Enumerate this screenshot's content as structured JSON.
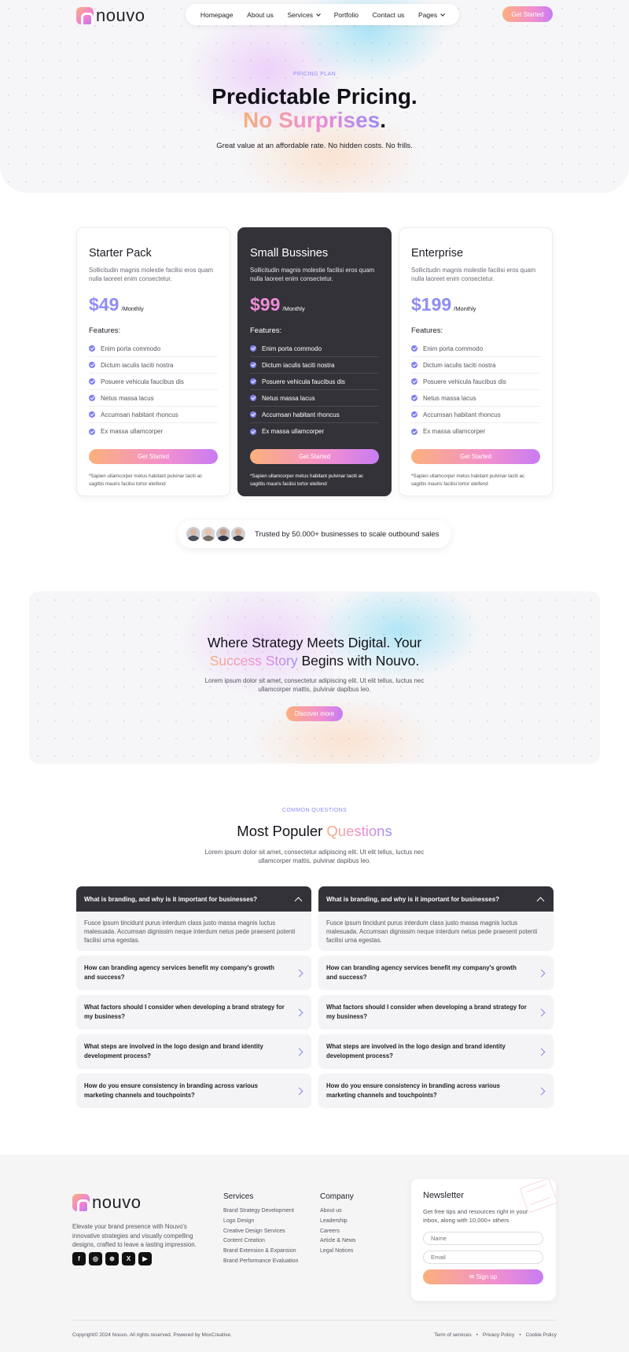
{
  "brand": {
    "name": "nouvo"
  },
  "nav": {
    "items": [
      {
        "label": "Homepage"
      },
      {
        "label": "About us"
      },
      {
        "label": "Services",
        "dropdown": true
      },
      {
        "label": "Portfolio"
      },
      {
        "label": "Contact us"
      },
      {
        "label": "Pages",
        "dropdown": true
      }
    ],
    "cta": "Get Started"
  },
  "hero": {
    "eyebrow": "PRICING PLAN",
    "title_line1": "Predictable Pricing.",
    "title_line2_highlight": "No Surprises",
    "title_line2_end": ".",
    "subtitle": "Great value at an affordable rate. No hidden costs. No frills."
  },
  "pricing": {
    "features_heading": "Features:",
    "plans": [
      {
        "name": "Starter Pack",
        "description": "Sollicitudin magnis molestie facilisi eros quam nulla laoreet enim consectetur.",
        "price": "$49",
        "period": "/Monthly",
        "features": [
          "Enim porta commodo",
          "Dictum iaculis taciti nostra",
          "Posuere vehicula faucibus dis",
          "Netus massa lacus",
          "Accumsan habitant rhoncus",
          "Ex massa ullamcorper"
        ],
        "cta": "Get Started",
        "note": "*Sapien ullamcorper metus habitant pulvinar taciti ac sagittis mauris facilisi tortor eleifend"
      },
      {
        "name": "Small Bussines",
        "description": "Sollicitudin magnis molestie facilisi eros quam nulla laoreet enim consectetur.",
        "price": "$99",
        "period": "/Monthly",
        "features": [
          "Enim porta commodo",
          "Dictum iaculis taciti nostra",
          "Posuere vehicula faucibus dis",
          "Netus massa lacus",
          "Accumsan habitant rhoncus",
          "Ex massa ullamcorper"
        ],
        "cta": "Get Started",
        "note": "*Sapien ullamcorper metus habitant pulvinar taciti ac sagittis mauris facilisi tortor eleifend"
      },
      {
        "name": "Enterprise",
        "description": "Sollicitudin magnis molestie facilisi eros quam nulla laoreet enim consectetur.",
        "price": "$199",
        "period": "/Monthly",
        "features": [
          "Enim porta commodo",
          "Dictum iaculis taciti nostra",
          "Posuere vehicula faucibus dis",
          "Netus massa lacus",
          "Accumsan habitant rhoncus",
          "Ex massa ullamcorper"
        ],
        "cta": "Get Started",
        "note": "*Sapien ullamcorper metus habitant pulvinar taciti ac sagittis mauris facilisi tortor eleifend"
      }
    ]
  },
  "trust": {
    "text": "Trusted by 50.000+ businesses to scale outbound sales"
  },
  "banner": {
    "title_line1": "Where Strategy Meets Digital. Your",
    "title_highlight": "Success Story",
    "title_line2_end": " Begins with Nouvo.",
    "text": "Lorem ipsum dolor sit amet, consectetur adipiscing elit. Ut elit tellus, luctus nec ullamcorper mattis, pulvinar dapibus leo.",
    "cta": "Discover more"
  },
  "faq": {
    "eyebrow": "COMMON QUESTIONS",
    "title": "Most Populer ",
    "title_highlight": "Questions",
    "subtitle": "Lorem ipsum dolor sit amet, consectetur adipiscing elit. Ut elit tellus, luctus nec ullamcorper mattis, pulvinar dapibus leo.",
    "columns": [
      {
        "open_question": "What is branding, and why is it important for businesses?",
        "open_answer": "Fusce ipsum tincidunt purus interdum class justo massa magnis luctus malesuada. Accumsan dignissim neque interdum netus pede praesent potenti facilisi urna egestas.",
        "questions": [
          "How can branding agency services benefit my company's growth and success?",
          "What factors should I consider when developing a brand strategy for my business?",
          "What steps are involved in the logo design and brand identity development process?",
          "How do you ensure consistency in branding across various marketing channels and touchpoints?"
        ]
      },
      {
        "open_question": "What is branding, and why is it important for businesses?",
        "open_answer": "Fusce ipsum tincidunt purus interdum class justo massa magnis luctus malesuada. Accumsan dignissim neque interdum netus pede praesent potenti facilisi urna egestas.",
        "questions": [
          "How can branding agency services benefit my company's growth and success?",
          "What factors should I consider when developing a brand strategy for my business?",
          "What steps are involved in the logo design and brand identity development process?",
          "How do you ensure consistency in branding across various marketing channels and touchpoints?"
        ]
      }
    ]
  },
  "footer": {
    "about": "Elevate your brand presence with Nouvo's innovative strategies and visually compelling designs, crafted to leave a lasting impression.",
    "socials": [
      {
        "icon": "facebook-icon",
        "glyph": "f"
      },
      {
        "icon": "instagram-icon",
        "glyph": "◎"
      },
      {
        "icon": "dribbble-icon",
        "glyph": "⊛"
      },
      {
        "icon": "x-icon",
        "glyph": "X"
      },
      {
        "icon": "youtube-icon",
        "glyph": "▶"
      }
    ],
    "services": {
      "heading": "Services",
      "links": [
        "Brand Strategy Development",
        "Logo Design",
        "Creative Design Services",
        "Content Creation",
        "Brand Extension & Expansion",
        "Brand Performance Evaluation"
      ]
    },
    "company": {
      "heading": "Company",
      "links": [
        "About us",
        "Leadership",
        "Careers",
        "Article & News",
        "Legal Notices"
      ]
    },
    "newsletter": {
      "heading": "Newsletter",
      "text": "Get free tips and resources right in your inbox, along with 10,000+ others",
      "name_placeholder": "Name",
      "email_placeholder": "Email",
      "cta": "Sign up"
    },
    "copyright": "Copyright© 2024 Nouvo. All rights reserved. Powered by MoxCreative.",
    "legal": [
      "Term of services",
      "Privacy Policy",
      "Cookie Policy"
    ]
  },
  "colors": {
    "accent": "#8f8df2",
    "pink": "#f08cd8",
    "peach": "#fbb07c",
    "dark": "#333238"
  }
}
